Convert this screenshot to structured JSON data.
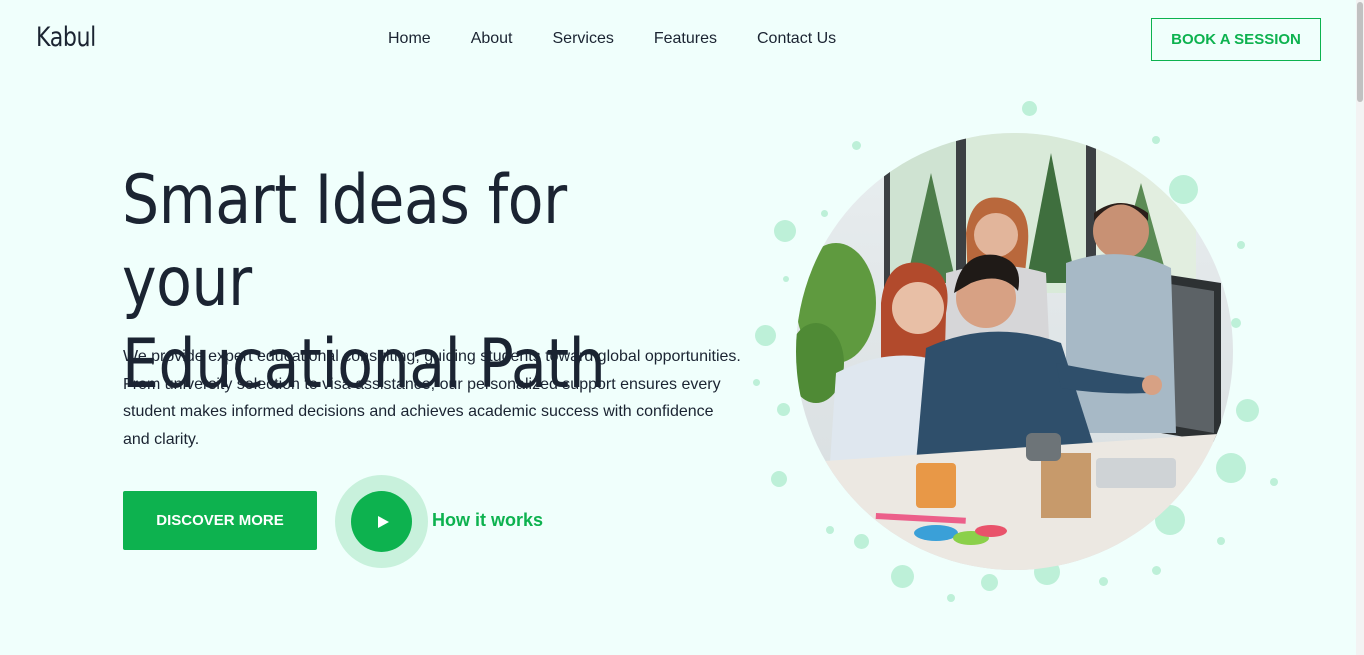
{
  "brand": {
    "name": "Kabul"
  },
  "nav": {
    "items": [
      {
        "label": "Home"
      },
      {
        "label": "About"
      },
      {
        "label": "Services"
      },
      {
        "label": "Features"
      },
      {
        "label": "Contact Us"
      }
    ]
  },
  "header": {
    "cta_label": "BOOK A SESSION"
  },
  "hero": {
    "title_line1": "Smart Ideas for your",
    "title_line2": "Educational Path",
    "description": "We provide expert educational consulting, guiding students toward global opportunities. From university selection to visa assistance, our personalized support ensures every student makes informed decisions and achieves academic success with confidence and clarity.",
    "primary_button": "DISCOVER MORE",
    "video_link": "How it works",
    "image": "office-team-photo"
  },
  "colors": {
    "accent": "#0db24f",
    "background": "#f0fffc",
    "text": "#1b2432",
    "bubble": "#bdf0d8"
  }
}
